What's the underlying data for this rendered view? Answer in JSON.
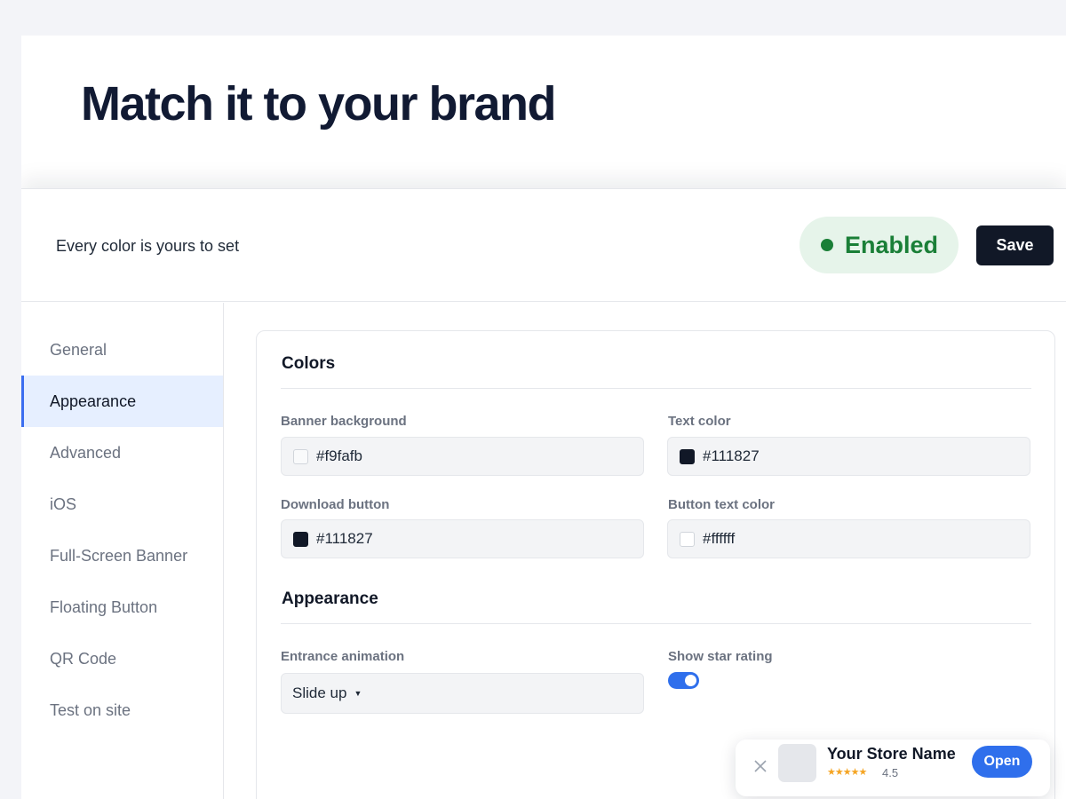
{
  "hero": {
    "title": "Match it to your brand"
  },
  "header": {
    "subtitle": "Every color is yours to set",
    "status": "Enabled",
    "save_label": "Save"
  },
  "sidebar": {
    "items": [
      {
        "label": "General",
        "active": false
      },
      {
        "label": "Appearance",
        "active": true
      },
      {
        "label": "Advanced",
        "active": false
      },
      {
        "label": "iOS",
        "active": false
      },
      {
        "label": "Full-Screen Banner",
        "active": false
      },
      {
        "label": "Floating Button",
        "active": false
      },
      {
        "label": "QR Code",
        "active": false
      },
      {
        "label": "Test on site",
        "active": false
      }
    ]
  },
  "colors_section": {
    "title": "Colors",
    "fields": [
      {
        "label": "Banner background",
        "value": "#f9fafb",
        "swatch": "#f9fafb"
      },
      {
        "label": "Text color",
        "value": "#111827",
        "swatch": "#111827"
      },
      {
        "label": "Download button",
        "value": "#111827",
        "swatch": "#111827"
      },
      {
        "label": "Button text color",
        "value": "#ffffff",
        "swatch": "#ffffff"
      }
    ]
  },
  "appearance_section": {
    "title": "Appearance",
    "animation_label": "Entrance animation",
    "animation_value": "Slide up",
    "star_label": "Show star rating",
    "star_enabled": true
  },
  "preview": {
    "store_name": "Your Store Name",
    "stars": "★★★★★",
    "rating": "4.5",
    "open_label": "Open"
  },
  "colors": {
    "accent": "#2f6fec",
    "status_green": "#1a7f37",
    "dark": "#111827"
  }
}
